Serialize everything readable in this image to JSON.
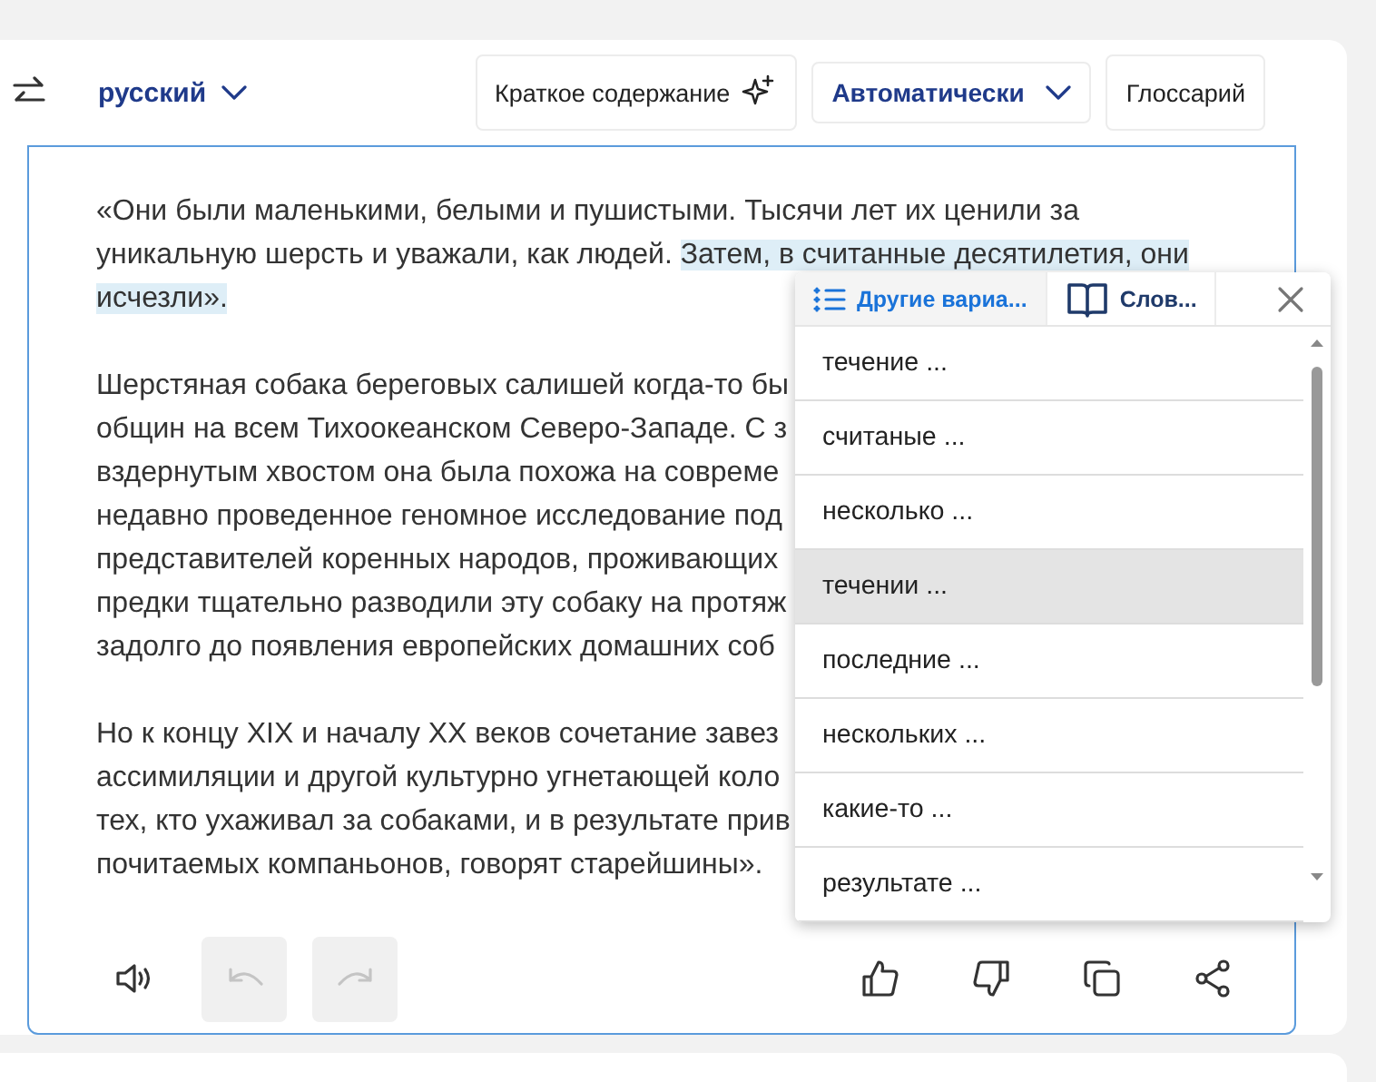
{
  "header": {
    "target_language": "русский",
    "summary_button": "Краткое содержание",
    "mode_dropdown": "Автоматически",
    "glossary_button": "Глоссарий"
  },
  "paragraphs": [
    [
      [
        {
          "text": "«Они были маленькими, белыми и пушистыми. Тысячи лет их ценили за",
          "highlighted": false
        }
      ],
      [
        {
          "text": "уникальную шерсть и уважали, как людей. ",
          "highlighted": false
        },
        {
          "text": "Затем, в считанные десятилетия, они",
          "highlighted": true
        }
      ],
      [
        {
          "text": "исчезли».",
          "highlighted": true
        }
      ]
    ],
    [
      [
        {
          "text": "Шерстяная собака береговых салишей когда-то бы",
          "highlighted": false
        }
      ],
      [
        {
          "text": "общин на всем Тихоокеанском Северо-Западе. С з",
          "highlighted": false
        }
      ],
      [
        {
          "text": "вздернутым хвостом она была похожа на совреме",
          "highlighted": false
        }
      ],
      [
        {
          "text": "недавно проведенное геномное исследование под",
          "highlighted": false
        }
      ],
      [
        {
          "text": "представителей коренных народов, проживающих",
          "highlighted": false
        }
      ],
      [
        {
          "text": "предки тщательно разводили эту собаку на протяж",
          "highlighted": false
        }
      ],
      [
        {
          "text": "задолго до появления европейских домашних соб",
          "highlighted": false
        }
      ]
    ],
    [
      [
        {
          "text": "Но к концу XIX и началу XX веков сочетание завез",
          "highlighted": false
        }
      ],
      [
        {
          "text": "ассимиляции и другой культурно угнетающей коло",
          "highlighted": false
        }
      ],
      [
        {
          "text": "тех, кто ухаживал за собаками, и в результате прив",
          "highlighted": false
        }
      ],
      [
        {
          "text": "почитаемых компаньонов, говорят старейшины».",
          "highlighted": false
        }
      ]
    ]
  ],
  "toolbar": {
    "undo_disabled": true,
    "redo_disabled": true
  },
  "popup": {
    "tabs": [
      {
        "label": "Другие вариа...",
        "selected": true,
        "kind": "list"
      },
      {
        "label": "Слов...",
        "selected": false,
        "kind": "book"
      }
    ],
    "items": [
      {
        "text": "течение ...",
        "selected": false
      },
      {
        "text": "считаные ...",
        "selected": false
      },
      {
        "text": "несколько ...",
        "selected": false
      },
      {
        "text": "течении ...",
        "selected": true
      },
      {
        "text": "последние ...",
        "selected": false
      },
      {
        "text": "нескольких ...",
        "selected": false
      },
      {
        "text": "какие-то ...",
        "selected": false
      },
      {
        "text": "результате ...",
        "selected": false
      }
    ]
  }
}
